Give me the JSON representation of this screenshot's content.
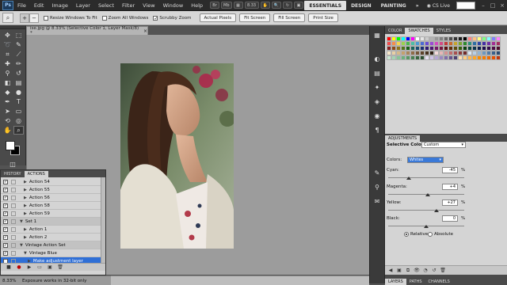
{
  "menubar": {
    "logo": "Ps",
    "items": [
      "File",
      "Edit",
      "Image",
      "Layer",
      "Select",
      "Filter",
      "View",
      "Window",
      "Help"
    ],
    "zoom": "8.33",
    "workspaces": [
      "ESSENTIALS",
      "DESIGN",
      "PAINTING",
      "»"
    ],
    "cs_live": "CS Live"
  },
  "options": {
    "resize_windows": "Resize Windows To Fit",
    "zoom_all": "Zoom All Windows",
    "scrubby": "Scrubby Zoom",
    "buttons": [
      "Actual Pixels",
      "Fit Screen",
      "Fill Screen",
      "Print Size"
    ]
  },
  "document": {
    "tab_title": "ise.jpg @ 8.33% (Selective Color 1, Layer Mask/8) *",
    "close": "×"
  },
  "swatch_panel": {
    "tabs": [
      "COLOR",
      "SWATCHES",
      "STYLES"
    ],
    "colors": [
      "#ff0000",
      "#ffff00",
      "#00ff00",
      "#00ffff",
      "#0000ff",
      "#ff00ff",
      "#ffffff",
      "#e6e6e6",
      "#cccccc",
      "#b3b3b3",
      "#999999",
      "#808080",
      "#666666",
      "#4d4d4d",
      "#333333",
      "#1a1a1a",
      "#000000",
      "#ff8080",
      "#ffbf80",
      "#ffff80",
      "#80ff80",
      "#80ffff",
      "#8080ff",
      "#ff80ff",
      "#f24b4b",
      "#f78c4b",
      "#f6d64b",
      "#9ad44b",
      "#4bb84b",
      "#4bbfa5",
      "#4b9ad4",
      "#4b6ad4",
      "#6a4bd4",
      "#9a4bd4",
      "#d44bc1",
      "#d44b84",
      "#c23b3b",
      "#c66a2e",
      "#c6a52e",
      "#78a52e",
      "#2e8a2e",
      "#2e8f7a",
      "#2e6fa5",
      "#2e45a5",
      "#452ea5",
      "#6f2ea5",
      "#a52e94",
      "#a52e5f",
      "#8a1f1f",
      "#8f4a18",
      "#8f7418",
      "#527418",
      "#186118",
      "#18655a",
      "#184c74",
      "#182e74",
      "#2e1874",
      "#4c1874",
      "#741866",
      "#741840",
      "#5c1010",
      "#5e2f0c",
      "#5e4c0c",
      "#355e0c",
      "#0c420c",
      "#0c453c",
      "#0c334e",
      "#0c1d4e",
      "#1d0c4e",
      "#330c4e",
      "#4e0c45",
      "#4e0c2a",
      "#f6e6c8",
      "#e8d0a5",
      "#d6b987",
      "#c4a16c",
      "#a98559",
      "#8f6c47",
      "#765638",
      "#5d432a",
      "#46311e",
      "#2f2013",
      "#f3d9d9",
      "#e7b6b6",
      "#d49191",
      "#c06c6c",
      "#a85050",
      "#8c3a3a",
      "#702a2a",
      "#d9e6f3",
      "#b6cfe7",
      "#91b5d4",
      "#6c98c0",
      "#507ba8",
      "#3a618c",
      "#2a4a70",
      "#c8e6d0",
      "#a5d4b2",
      "#87c496",
      "#6cb07c",
      "#599864",
      "#477f50",
      "#38663f",
      "#2a4e30",
      "#e6e0f3",
      "#cfc4e7",
      "#b5a6d4",
      "#9a88c0",
      "#806ca8",
      "#66538c",
      "#4e3f70",
      "#ffe0b3",
      "#ffcc80",
      "#ffb74d",
      "#ffa726",
      "#fb8c00",
      "#f57c00",
      "#ef6c00",
      "#e65100",
      "#bf360c"
    ]
  },
  "adjustments": {
    "tab": "ADJUSTMENTS",
    "title": "Selective Color",
    "preset": "Custom",
    "colors_label": "Colors:",
    "colors_value": "Whites",
    "cyan_label": "Cyan:",
    "cyan": "-45",
    "magenta_label": "Magenta:",
    "magenta": "+4",
    "yellow_label": "Yellow:",
    "yellow": "+27",
    "black_label": "Black:",
    "black": "0",
    "percent": "%",
    "relative": "Relative",
    "absolute": "Absolute"
  },
  "layers_tabs": [
    "LAYERS",
    "PATHS",
    "CHANNELS"
  ],
  "actions": {
    "tabs": [
      "HISTORY",
      "ACTIONS"
    ],
    "rows": [
      {
        "label": "Action 54",
        "set": false,
        "hl": false,
        "tri": "▶",
        "indent": 2
      },
      {
        "label": "Action 55",
        "set": false,
        "hl": false,
        "tri": "▶",
        "indent": 2
      },
      {
        "label": "Action 56",
        "set": false,
        "hl": false,
        "tri": "▶",
        "indent": 2
      },
      {
        "label": "Action 58",
        "set": false,
        "hl": false,
        "tri": "▶",
        "indent": 2
      },
      {
        "label": "Action 59",
        "set": false,
        "hl": false,
        "tri": "▶",
        "indent": 2
      },
      {
        "label": "Set 1",
        "set": true,
        "hl": false,
        "tri": "▼",
        "indent": 1
      },
      {
        "label": "Action 1",
        "set": false,
        "hl": false,
        "tri": "▶",
        "indent": 2
      },
      {
        "label": "Action 2",
        "set": false,
        "hl": false,
        "tri": "▶",
        "indent": 2
      },
      {
        "label": "Vintage Action Set",
        "set": true,
        "hl": false,
        "tri": "▼",
        "indent": 1
      },
      {
        "label": "Vintage Blue",
        "set": false,
        "hl": false,
        "tri": "▼",
        "indent": 2
      },
      {
        "label": "Make adjustment layer",
        "set": false,
        "hl": true,
        "tri": "▶",
        "indent": 3
      }
    ]
  },
  "status": {
    "zoom": "8.33%",
    "message": "Exposure works in 32-bit only"
  }
}
